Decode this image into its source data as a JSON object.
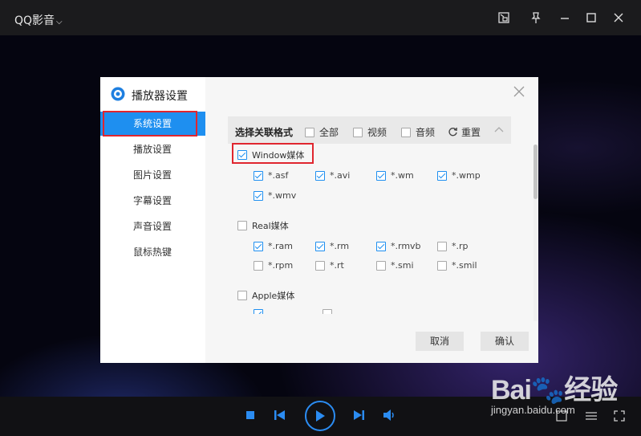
{
  "app": {
    "title": "QQ影音"
  },
  "watermark": {
    "brand": "Bai🐾经验",
    "url": "jingyan.baidu.com"
  },
  "dialog": {
    "title": "播放器设置",
    "nav": [
      "系统设置",
      "播放设置",
      "图片设置",
      "字幕设置",
      "声音设置",
      "鼠标热键"
    ],
    "active_nav": "系统设置",
    "section": {
      "label": "选择关联格式",
      "opt_all": "全部",
      "opt_video": "视频",
      "opt_audio": "音频",
      "reset": "重置"
    },
    "groups": [
      {
        "name": "Window媒体",
        "checked": true,
        "formats": [
          {
            "ext": "*.asf",
            "checked": true
          },
          {
            "ext": "*.avi",
            "checked": true
          },
          {
            "ext": "*.wm",
            "checked": true
          },
          {
            "ext": "*.wmp",
            "checked": true
          },
          {
            "ext": "*.wmv",
            "checked": true
          }
        ]
      },
      {
        "name": "Real媒体",
        "checked": false,
        "formats": [
          {
            "ext": "*.ram",
            "checked": true
          },
          {
            "ext": "*.rm",
            "checked": true
          },
          {
            "ext": "*.rmvb",
            "checked": true
          },
          {
            "ext": "*.rp",
            "checked": false
          },
          {
            "ext": "*.rpm",
            "checked": false
          },
          {
            "ext": "*.rt",
            "checked": false
          },
          {
            "ext": "*.smi",
            "checked": false
          },
          {
            "ext": "*.smil",
            "checked": false
          }
        ]
      },
      {
        "name": "Apple媒体",
        "checked": false
      }
    ],
    "buttons": {
      "cancel": "取消",
      "confirm": "确认"
    }
  },
  "colors": {
    "accent": "#1e8ff0",
    "highlight": "#e0262f"
  }
}
